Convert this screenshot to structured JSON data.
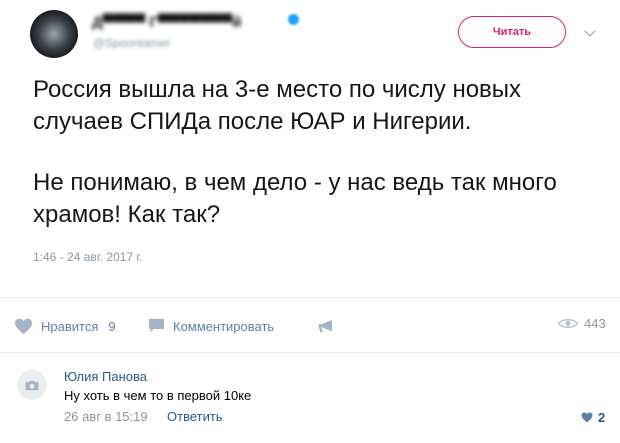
{
  "tweet": {
    "author_name": "Д▀▀▀▀ Г▀▀▀▀▀▀▀й",
    "author_handle": "@Spoontamer",
    "follow_label": "Читать",
    "text_paragraph_1": "Россия вышла на 3-е место по числу новых случаев СПИДа после ЮАР и Нигерии.",
    "text_paragraph_2": "Не понимаю, в чем дело - у нас ведь так много храмов! Как так?",
    "timestamp": "1:46 - 24 авг. 2017 г."
  },
  "actions": {
    "like_label": "Нравится",
    "like_count": "9",
    "comment_label": "Комментировать",
    "views_count": "443"
  },
  "comment": {
    "author": "Юлия Панова",
    "text": "Ну хоть в чем то в первой 10ке",
    "date": "26 авг в 15:19",
    "reply_label": "Ответить",
    "like_count": "2"
  },
  "icons": {
    "chevron": "chevron-down-icon",
    "verified": "verified-badge-icon",
    "like": "heart-icon",
    "comment": "comment-icon",
    "share": "share-megaphone-icon",
    "views": "eye-icon",
    "camera": "camera-icon"
  },
  "colors": {
    "follow_accent": "#e0245e",
    "vk_blue": "#2a5885",
    "action_blue": "#5e81a8",
    "muted": "#939393",
    "twitter_muted": "#8899a6"
  }
}
